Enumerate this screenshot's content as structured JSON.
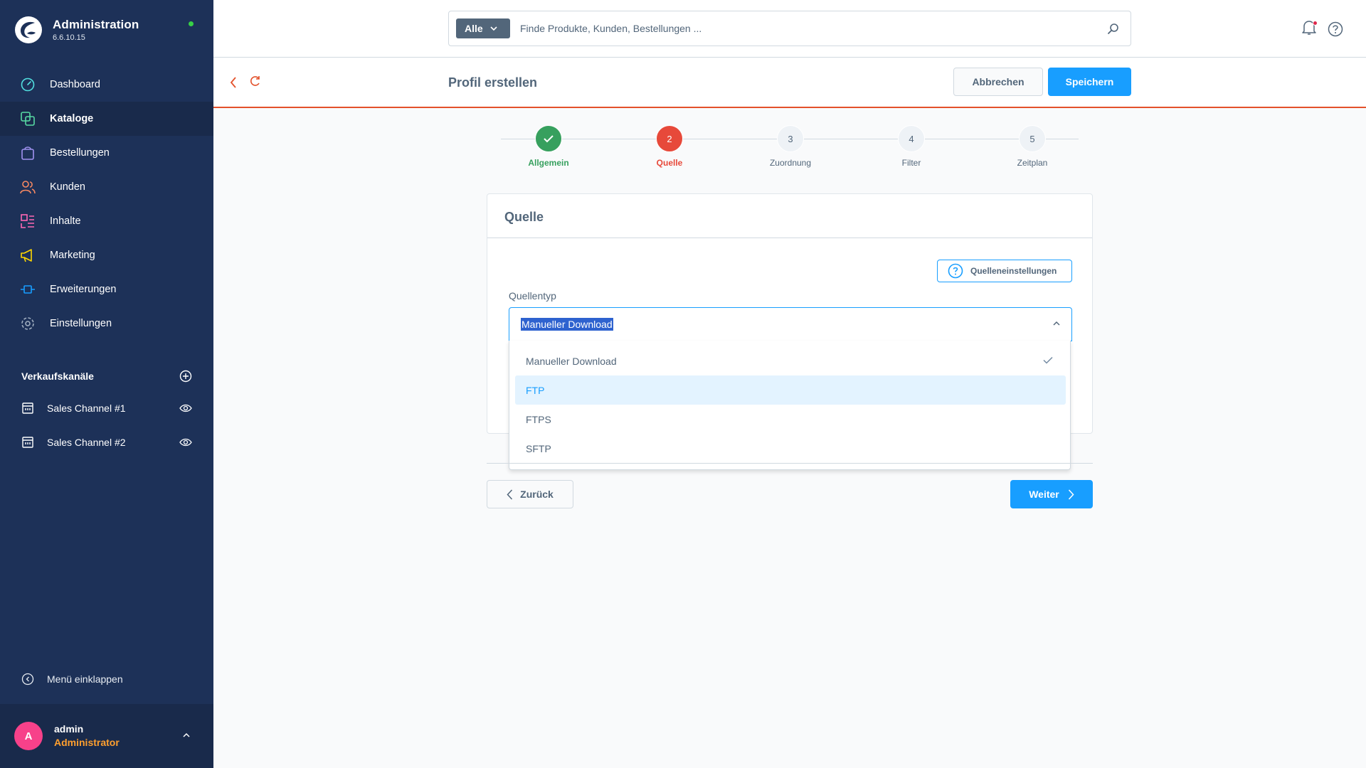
{
  "app": {
    "title": "Administration",
    "version": "6.6.10.15"
  },
  "nav": [
    {
      "label": "Dashboard",
      "icon": "dashboard-icon"
    },
    {
      "label": "Kataloge",
      "icon": "catalogue-icon",
      "active": true
    },
    {
      "label": "Bestellungen",
      "icon": "orders-icon"
    },
    {
      "label": "Kunden",
      "icon": "customers-icon"
    },
    {
      "label": "Inhalte",
      "icon": "content-icon"
    },
    {
      "label": "Marketing",
      "icon": "marketing-icon"
    },
    {
      "label": "Erweiterungen",
      "icon": "extensions-icon"
    },
    {
      "label": "Einstellungen",
      "icon": "settings-icon"
    }
  ],
  "sales_channels": {
    "title": "Verkaufskanäle",
    "items": [
      {
        "label": "Sales Channel #1"
      },
      {
        "label": "Sales Channel #2"
      }
    ]
  },
  "collapse_label": "Menü einklappen",
  "user": {
    "initial": "A",
    "name": "admin",
    "role": "Administrator"
  },
  "search": {
    "type": "Alle",
    "placeholder": "Finde Produkte, Kunden, Bestellungen ..."
  },
  "page": {
    "title": "Profil erstellen",
    "cancel": "Abbrechen",
    "save": "Speichern"
  },
  "steps": [
    {
      "label": "Allgemein",
      "num": "",
      "status": "done"
    },
    {
      "label": "Quelle",
      "num": "2",
      "status": "current"
    },
    {
      "label": "Zuordnung",
      "num": "3",
      "status": "pending"
    },
    {
      "label": "Filter",
      "num": "4",
      "status": "pending"
    },
    {
      "label": "Zeitplan",
      "num": "5",
      "status": "pending"
    }
  ],
  "card": {
    "title": "Quelle",
    "help_button": "Quelleneinstellungen",
    "field_label": "Quellentyp",
    "selected_value": "Manueller Download",
    "options": [
      "Manueller Download",
      "FTP",
      "FTPS",
      "SFTP"
    ]
  },
  "footer": {
    "back": "Zurück",
    "next": "Weiter"
  },
  "colors": {
    "sidebar": "#1d3158",
    "accent": "#189eff",
    "done": "#37a05e",
    "current": "#e7493a"
  }
}
